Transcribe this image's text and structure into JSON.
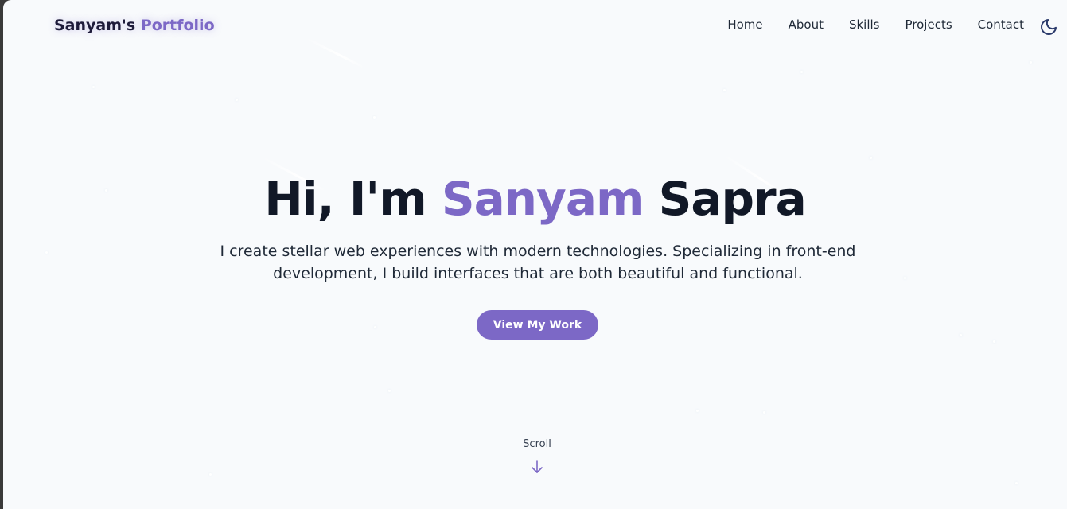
{
  "header": {
    "logo_primary": "Sanyam's",
    "logo_accent": "Portfolio",
    "nav": [
      "Home",
      "About",
      "Skills",
      "Projects",
      "Contact"
    ],
    "theme_icon": "moon-icon"
  },
  "hero": {
    "greeting": "Hi, I'm",
    "first_name": "Sanyam",
    "last_name": "Sapra",
    "description": "I create stellar web experiences with modern technologies. Specializing in front-end development, I build interfaces that are both beautiful and functional.",
    "cta_label": "View My Work"
  },
  "scroll": {
    "label": "Scroll",
    "icon": "arrow-down-icon"
  },
  "colors": {
    "accent": "#7c68c6",
    "text": "#111827",
    "background": "#f8fafc"
  }
}
